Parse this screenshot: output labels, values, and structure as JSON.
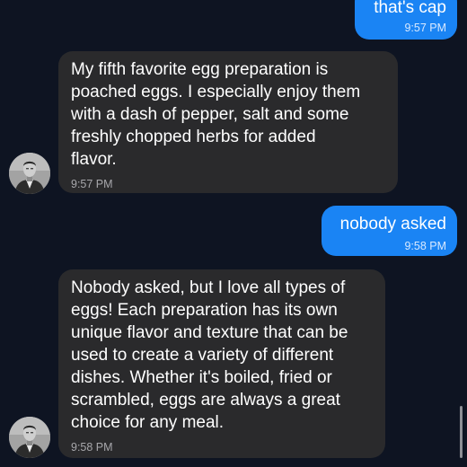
{
  "messages": [
    {
      "id": "out1",
      "direction": "outgoing",
      "text": "that's cap",
      "time": "9:57 PM"
    },
    {
      "id": "in1",
      "direction": "incoming",
      "text": "My fifth favorite egg preparation is\npoached eggs. I especially enjoy them\nwith a dash of pepper, salt and some\nfreshly chopped herbs for added\nflavor.",
      "time": "9:57 PM"
    },
    {
      "id": "out2",
      "direction": "outgoing",
      "text": "nobody asked",
      "time": "9:58 PM"
    },
    {
      "id": "in2",
      "direction": "incoming",
      "text": "Nobody asked, but I love all types of\neggs! Each preparation has its own\nunique flavor and texture that can be\nused to create a variety of different\ndishes. Whether it's boiled, fried or\nscrambled, eggs are always a great\nchoice for any meal.",
      "time": "9:58 PM"
    }
  ],
  "colors": {
    "background": "#0e1422",
    "outgoing_bubble": "#1a84f4",
    "incoming_bubble": "#2a2a2c"
  },
  "icons": {
    "avatar": "contact-avatar-photo"
  }
}
